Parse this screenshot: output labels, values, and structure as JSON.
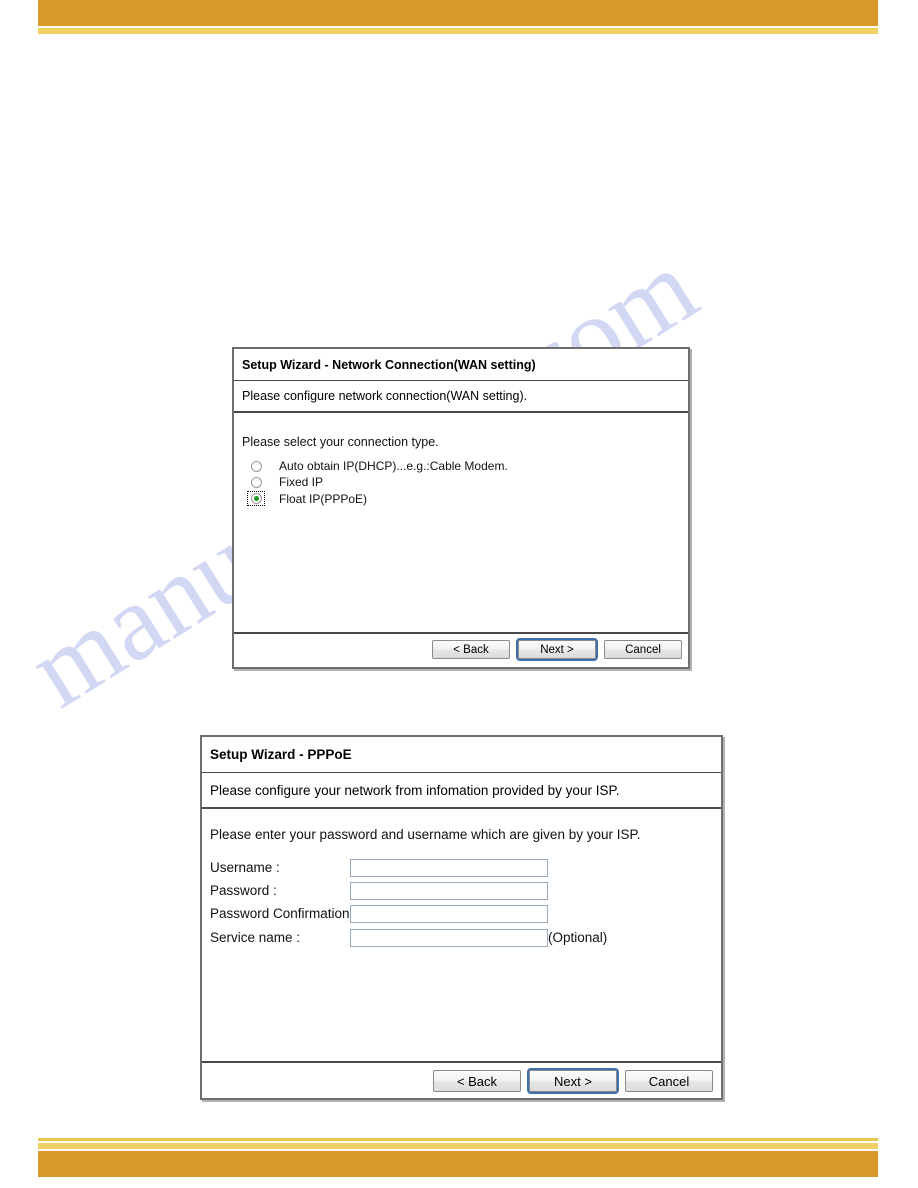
{
  "page": {
    "background_color": "#ffffff",
    "band_color": "#d9982a",
    "band_accent_color": "#f0d062",
    "watermark_text": "manualshive.com",
    "watermark_color": "#b9c0e8"
  },
  "dialog_wan": {
    "title": "Setup Wizard - Network Connection(WAN setting)",
    "subtitle": "Please configure network connection(WAN setting).",
    "body_prompt": "Please select your connection type.",
    "options": [
      {
        "label": "Auto obtain IP(DHCP)...e.g.:Cable Modem.",
        "selected": false,
        "focused": false
      },
      {
        "label": "Fixed IP",
        "selected": false,
        "focused": false
      },
      {
        "label": "Float IP(PPPoE)",
        "selected": true,
        "focused": true
      }
    ],
    "buttons": {
      "back": "< Back",
      "next": "Next >",
      "cancel": "Cancel",
      "focused": "next"
    }
  },
  "dialog_pppoe": {
    "title": "Setup Wizard - PPPoE",
    "subtitle": "Please configure your network from infomation provided by your ISP.",
    "body_prompt": "Please enter your password and username which are given by your ISP.",
    "fields": [
      {
        "label": "Username :",
        "value": "",
        "placeholder": "",
        "note": ""
      },
      {
        "label": "Password :",
        "value": "",
        "placeholder": "",
        "note": ""
      },
      {
        "label": "Password Confirmation :",
        "value": "",
        "placeholder": "",
        "note": ""
      },
      {
        "label": "Service name :",
        "value": "",
        "placeholder": "",
        "note": "(Optional)"
      }
    ],
    "buttons": {
      "back": "< Back",
      "next": "Next >",
      "cancel": "Cancel",
      "focused": "next"
    }
  }
}
